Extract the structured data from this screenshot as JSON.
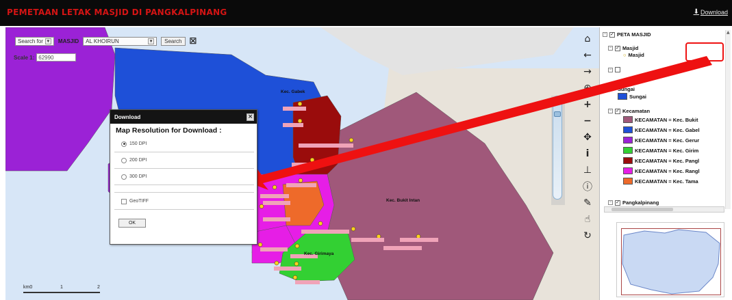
{
  "header": {
    "title": "PEMETAAN LETAK MASJID DI PANGKALPINANG",
    "download_label": "Download",
    "download_icon": "download-icon"
  },
  "search": {
    "search_for_label": "Search for",
    "masjid_label": "MASJID",
    "masjid_value": "AL KHOIRUN",
    "search_button": "Search",
    "clear_icon": "close-icon"
  },
  "scale": {
    "label": "Scale 1:",
    "value": "62990"
  },
  "scalebar": {
    "unit": "km",
    "ticks": [
      "0",
      "1",
      "2"
    ]
  },
  "tools": [
    {
      "name": "home-icon",
      "glyph": "⌂"
    },
    {
      "name": "pan-left-icon",
      "glyph": "←"
    },
    {
      "name": "pan-right-icon",
      "glyph": "→"
    },
    {
      "name": "globe-icon",
      "glyph": "⊕"
    },
    {
      "name": "zoom-in-icon",
      "glyph": "+"
    },
    {
      "name": "zoom-out-icon",
      "glyph": "−"
    },
    {
      "name": "pan-icon",
      "glyph": "✥"
    },
    {
      "name": "info-icon",
      "glyph": "i"
    },
    {
      "name": "measure-icon",
      "glyph": "⊥"
    },
    {
      "name": "identify-icon",
      "glyph": "ⓘ"
    },
    {
      "name": "pencil-icon",
      "glyph": "✎"
    },
    {
      "name": "hand-icon",
      "glyph": "☝"
    },
    {
      "name": "refresh-icon",
      "glyph": "↻"
    }
  ],
  "map_labels": {
    "kec_gabek": "Kec. Gabek",
    "kec_bukit_intan": "Kec. Bukit Intan",
    "kec_girimaya": "Kec. Girimaya"
  },
  "layers": {
    "root": "PETA MASJID",
    "masjid_group": "Masjid",
    "masjid_item": "Masjid",
    "sungai_group": "Sungai",
    "sungai_item": "Sungai",
    "kecamatan_group": "Kecamatan",
    "kecamatan_items": [
      {
        "label": "KECAMATAN = Kec. Bukit",
        "color": "#a0587a"
      },
      {
        "label": "KECAMATAN = Kec. Gabel",
        "color": "#1e50d8"
      },
      {
        "label": "KECAMATAN = Kec. Gerur",
        "color": "#9b22d6"
      },
      {
        "label": "KECAMATAN = Kec. Girim",
        "color": "#33d033"
      },
      {
        "label": "KECAMATAN = Kec. Pangl",
        "color": "#9a0c0c"
      },
      {
        "label": "KECAMATAN = Kec. Rangl",
        "color": "#e61ee6"
      },
      {
        "label": "KECAMATAN = Kec. Tama",
        "color": "#ee6a2a"
      }
    ],
    "bottom_group": "Pangkalpinang"
  },
  "dialog": {
    "title": "Download",
    "heading": "Map Resolution for Download :",
    "options": [
      "150 DPI",
      "200 DPI",
      "300 DPI"
    ],
    "selected": "150 DPI",
    "geotiff_label": "GeoTIFF",
    "ok_label": "OK",
    "close_icon": "close-icon"
  },
  "colors": {
    "title_red": "#d41414",
    "sea": "#d7e6f7",
    "land": "#e8e3da",
    "bukit_intan": "#a0587a",
    "gabek": "#1e50d8",
    "gerunggang": "#9b22d6",
    "girimaya": "#33d033",
    "pangkalbalam": "#9a0c0c",
    "rangkui": "#e61ee6",
    "taman_sari": "#ee6a2a",
    "arrow": "#ee1111"
  }
}
